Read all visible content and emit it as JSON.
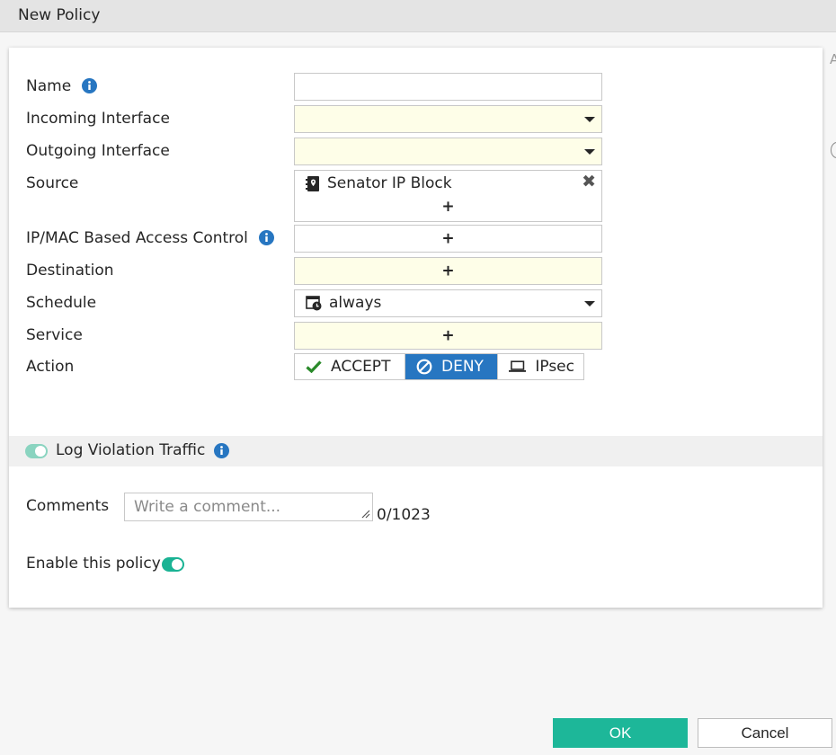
{
  "window": {
    "title": "New Policy",
    "edge_letter": "A"
  },
  "form": {
    "name": {
      "label": "Name",
      "value": ""
    },
    "incoming_interface": {
      "label": "Incoming Interface",
      "value": ""
    },
    "outgoing_interface": {
      "label": "Outgoing Interface",
      "value": ""
    },
    "source": {
      "label": "Source",
      "entries": [
        "Senator IP Block"
      ],
      "add": "+"
    },
    "ipmac": {
      "label": "IP/MAC Based Access Control",
      "add": "+"
    },
    "destination": {
      "label": "Destination",
      "add": "+"
    },
    "schedule": {
      "label": "Schedule",
      "value": "always"
    },
    "service": {
      "label": "Service",
      "add": "+"
    },
    "action": {
      "label": "Action",
      "options": [
        "ACCEPT",
        "DENY",
        "IPsec"
      ],
      "selected": "DENY"
    }
  },
  "log_violation": {
    "label": "Log Violation Traffic",
    "enabled": true
  },
  "comments": {
    "label": "Comments",
    "placeholder": "Write a comment...",
    "value": "",
    "count": "0/1023"
  },
  "enable_policy": {
    "label": "Enable this policy",
    "enabled": true
  },
  "buttons": {
    "ok": "OK",
    "cancel": "Cancel"
  },
  "colors": {
    "accent_blue": "#2776c1",
    "ok_green": "#1db799",
    "toggle_green": "#1ab394",
    "required_yellow": "#fefee8",
    "accept_check": "#2a8a2a"
  }
}
